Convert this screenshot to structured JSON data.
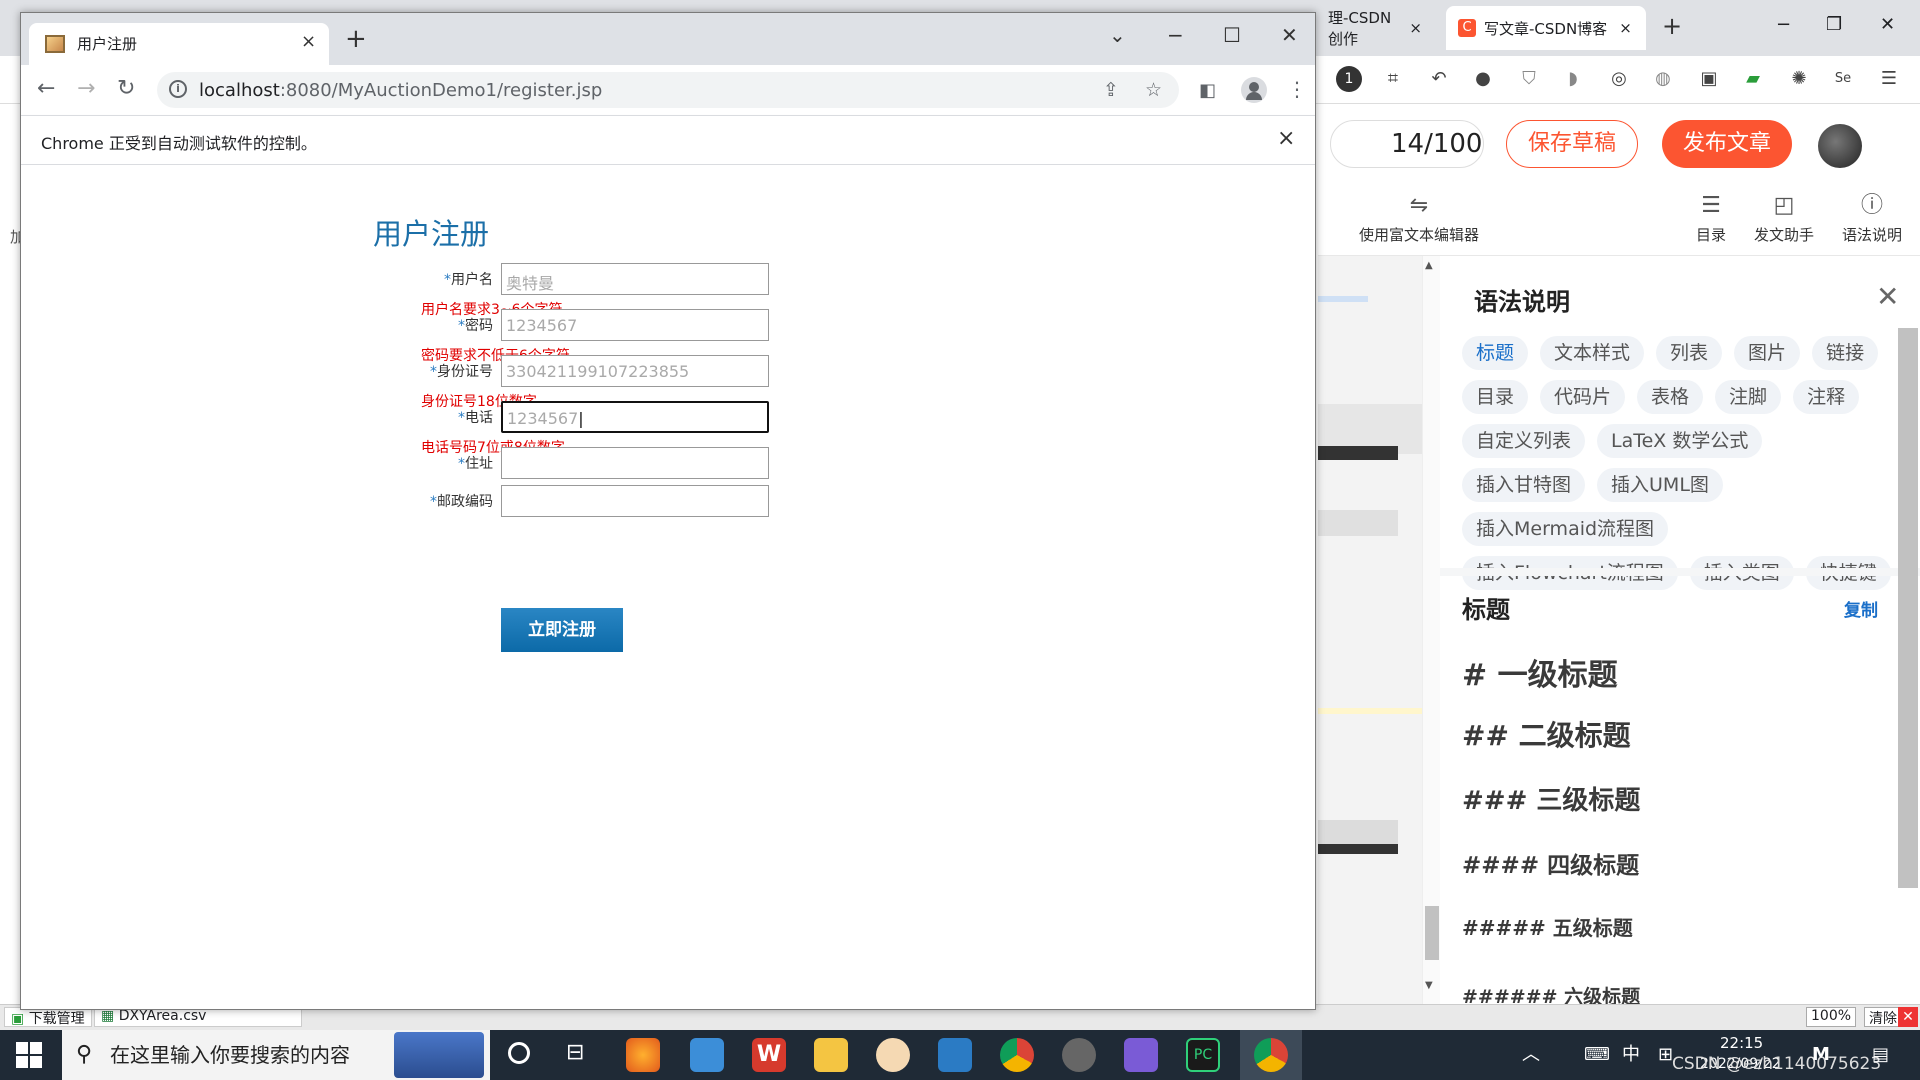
{
  "background_browser": {
    "tabs": [
      {
        "label": "理-CSDN创作",
        "close": "×"
      },
      {
        "label": "写文章-CSDN博客",
        "close": "×"
      }
    ],
    "new_tab": "+",
    "window_controls": {
      "minimize": "−",
      "restore": "❐",
      "close": "✕"
    },
    "left_edge_text": "加"
  },
  "csdn": {
    "word_count": "14/100",
    "save_draft": "保存草稿",
    "publish": "发布文章",
    "rich_editor": "使用富文本编辑器",
    "tools": [
      "目录",
      "发文助手",
      "语法说明"
    ],
    "panel": {
      "title": "语法说明",
      "close": "✕",
      "chips": [
        "标题",
        "文本样式",
        "列表",
        "图片",
        "链接",
        "目录",
        "代码片",
        "表格",
        "注脚",
        "注释",
        "自定义列表",
        "LaTeX 数学公式",
        "插入甘特图",
        "插入UML图",
        "插入Mermaid流程图",
        "插入Flowchart流程图",
        "插入类图",
        "快捷键"
      ],
      "section_title": "标题",
      "copy": "复制",
      "headings": [
        "# 一级标题",
        "## 二级标题",
        "### 三级标题",
        "#### 四级标题",
        "##### 五级标题",
        "###### 六级标题"
      ]
    }
  },
  "download_bar": {
    "items": [
      "下载管理",
      "DXYArea.csv"
    ],
    "zoom": "100%",
    "clear": "清除"
  },
  "taskbar": {
    "search_placeholder": "在这里输入你要搜索的内容",
    "time": "22:15",
    "date": "2022/09/22",
    "ime": "中",
    "watermark": "CSDN @ezh1140075623"
  },
  "window": {
    "tab_title": "用户注册",
    "tab_close": "×",
    "new_tab": "+",
    "controls": {
      "dropdown": "⌄",
      "minimize": "−",
      "maximize": "☐",
      "close": "✕"
    },
    "url_host": "localhost",
    "url_path": ":8080/MyAuctionDemo1/register.jsp",
    "infobar_text": "Chrome 正受到自动测试软件的控制。",
    "infobar_close": "×"
  },
  "form": {
    "title": "用户注册",
    "required_mark": "*",
    "fields": [
      {
        "label": "用户名",
        "value": "奥特曼",
        "hint": "用户名要求3~6个字符"
      },
      {
        "label": "密码",
        "value": "1234567",
        "hint": "密码要求不低于6个字符"
      },
      {
        "label": "身份证号",
        "value": "330421199107223855",
        "hint": "身份证号18位数字"
      },
      {
        "label": "电话",
        "value": "1234567",
        "hint": "电话号码7位或8位数字"
      },
      {
        "label": "住址",
        "value": "",
        "hint": ""
      },
      {
        "label": "邮政编码",
        "value": "",
        "hint": ""
      }
    ],
    "submit": "立即注册"
  }
}
